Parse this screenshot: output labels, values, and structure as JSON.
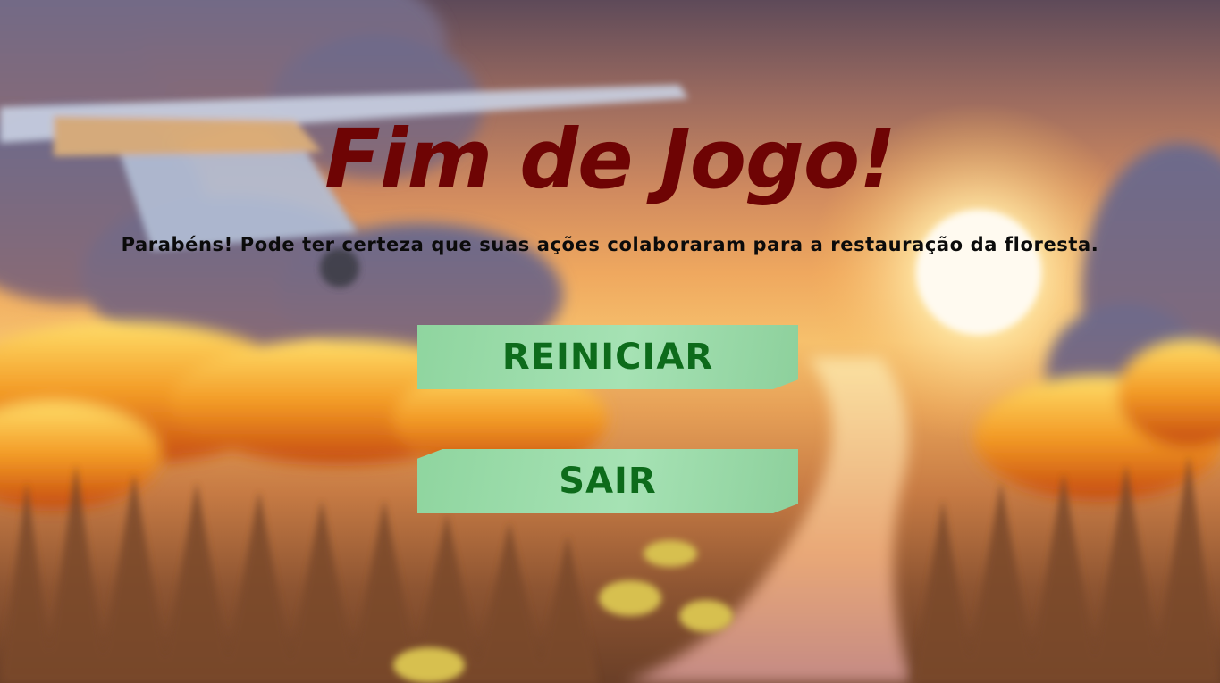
{
  "screen": {
    "title": "Fim de Jogo!",
    "message": "Parabéns! Pode ter certeza que suas ações colaboraram para a restauração da floresta."
  },
  "buttons": {
    "restart_label": "REINICIAR",
    "exit_label": "SAIR"
  },
  "colors": {
    "title": "#6e0404",
    "message": "#0b0b0b",
    "button_fill": "#a6e2b4",
    "button_text": "#0d6b1b"
  },
  "background": {
    "description_icon": "burning-forest-scene"
  }
}
